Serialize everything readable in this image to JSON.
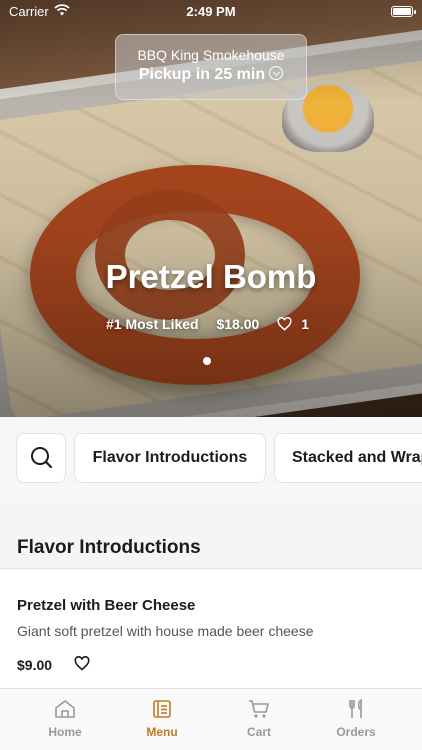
{
  "status_bar": {
    "carrier": "Carrier",
    "time": "2:49 PM"
  },
  "store": {
    "name": "BBQ King Smokehouse",
    "pickup": "Pickup in 25 min"
  },
  "hero": {
    "title": "Pretzel Bomb",
    "badge": "#1 Most Liked",
    "price": "$18.00",
    "likes": "1"
  },
  "chips": [
    "Flavor Introductions",
    "Stacked and Wrapped"
  ],
  "section": {
    "title": "Flavor Introductions"
  },
  "item": {
    "name": "Pretzel with Beer Cheese",
    "description": "Giant soft pretzel with house made beer cheese",
    "price": "$9.00"
  },
  "tabs": [
    {
      "label": "Home",
      "icon": "home-icon"
    },
    {
      "label": "Menu",
      "icon": "menu-icon"
    },
    {
      "label": "Cart",
      "icon": "cart-icon"
    },
    {
      "label": "Orders",
      "icon": "fork-knife-icon"
    }
  ],
  "colors": {
    "accent": "#c07a1f",
    "inactive": "#9a9a9a"
  }
}
